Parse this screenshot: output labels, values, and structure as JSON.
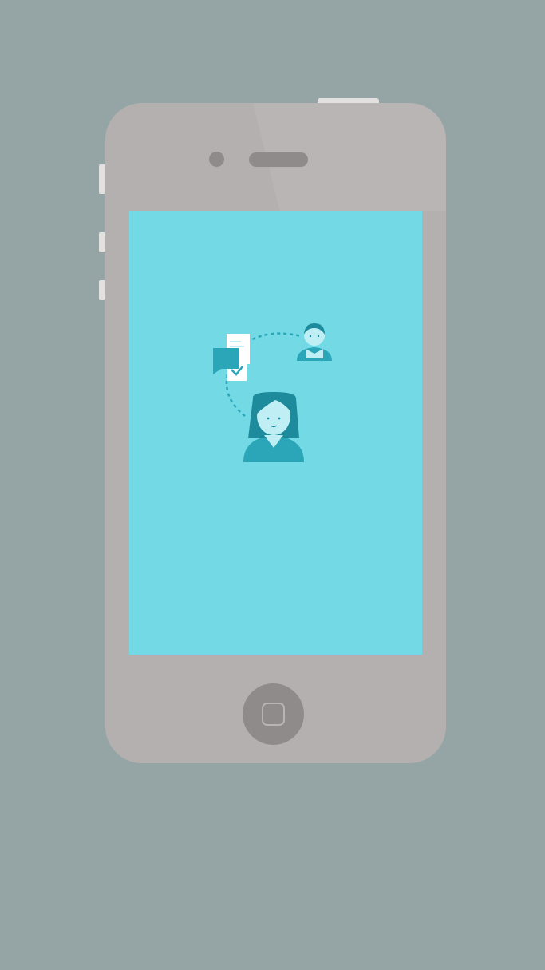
{
  "device": {
    "type": "smartphone",
    "body_color": "#b5b0b0",
    "background_color": "#95a5a5",
    "screen_color": "#73d9e4",
    "button_color": "#e3e0e0",
    "detail_color": "#8f8b8b"
  },
  "screen": {
    "illustration": {
      "icons": [
        "chat-bubble-icon",
        "document-check-icon",
        "man-avatar-icon",
        "woman-avatar-icon",
        "dashed-connection-icon"
      ],
      "accent_color": "#2aa6b8",
      "dark_color": "#1d8b9c",
      "light_color": "#ffffff"
    }
  },
  "home_button": {
    "icon": "home-square-icon"
  }
}
